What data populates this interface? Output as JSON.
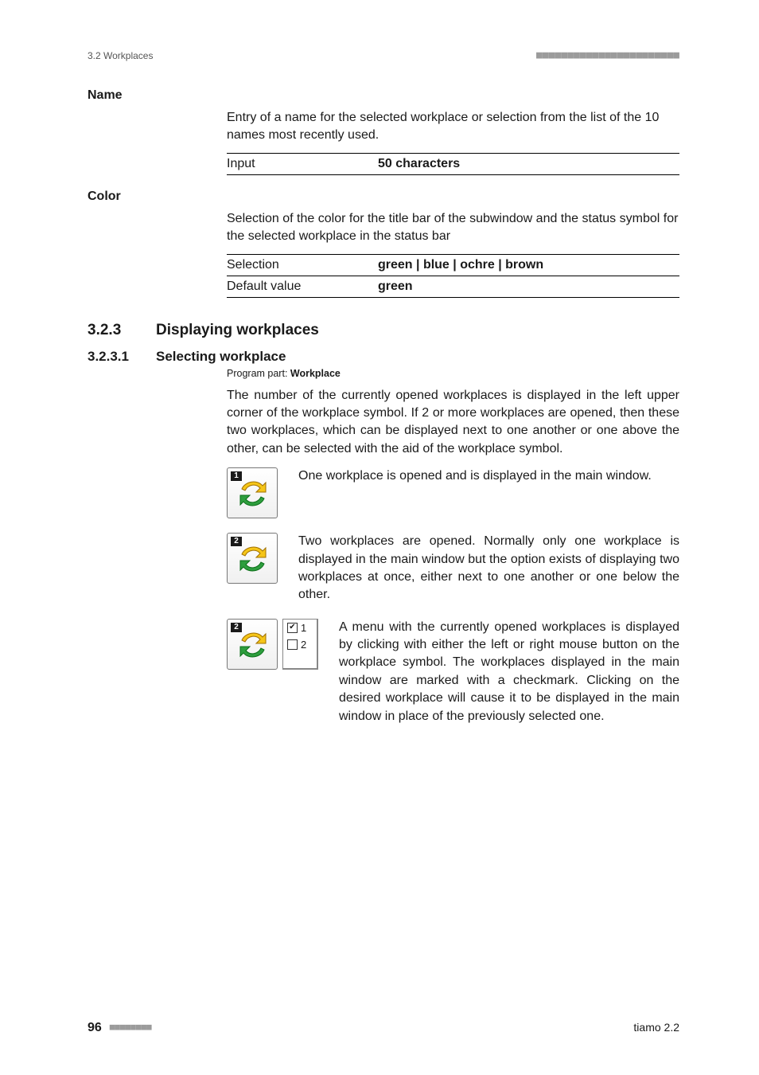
{
  "header": {
    "section": "3.2 Workplaces",
    "dots_right": "■■■■■■■■■■■■■■■■■■■■■■■"
  },
  "name": {
    "heading": "Name",
    "desc": "Entry of a name for the selected workplace or selection from the list of the 10 names most recently used.",
    "rows": [
      {
        "label": "Input",
        "value": "50 characters"
      }
    ]
  },
  "color": {
    "heading": "Color",
    "desc": "Selection of the color for the title bar of the subwindow and the status symbol for the selected workplace in the status bar",
    "rows": [
      {
        "label": "Selection",
        "value": "green | blue | ochre | brown"
      },
      {
        "label": "Default value",
        "value": "green"
      }
    ]
  },
  "s323": {
    "num": "3.2.3",
    "title": "Displaying workplaces"
  },
  "s3231": {
    "num": "3.2.3.1",
    "title": "Selecting workplace",
    "programPartLabel": "Program part: ",
    "programPartValue": "Workplace",
    "intro": "The number of the currently opened workplaces is displayed in the left upper corner of the workplace symbol. If 2 or more workplaces are opened, then these two workplaces, which can be displayed next to one another or one above the other, can be selected with the aid of the workplace symbol.",
    "item1": {
      "badge": "1",
      "text": "One workplace is opened and is displayed in the main window."
    },
    "item2": {
      "badge": "2",
      "text": "Two workplaces are opened. Normally only one workplace is displayed in the main window but the option exists of displaying two workplaces at once, either next to one another or one below the other."
    },
    "item3": {
      "badge": "2",
      "menu": {
        "opt1": "1",
        "opt2": "2"
      },
      "text": "A menu with the currently opened workplaces is displayed by clicking with either the left or right mouse button on the workplace symbol. The workplaces displayed in the main window are marked with a checkmark. Clicking on the desired workplace will cause it to be displayed in the main window in place of the previously selected one."
    }
  },
  "footer": {
    "page": "96",
    "dots_left": "■■■■■■■■",
    "product": "tiamo 2.2"
  }
}
